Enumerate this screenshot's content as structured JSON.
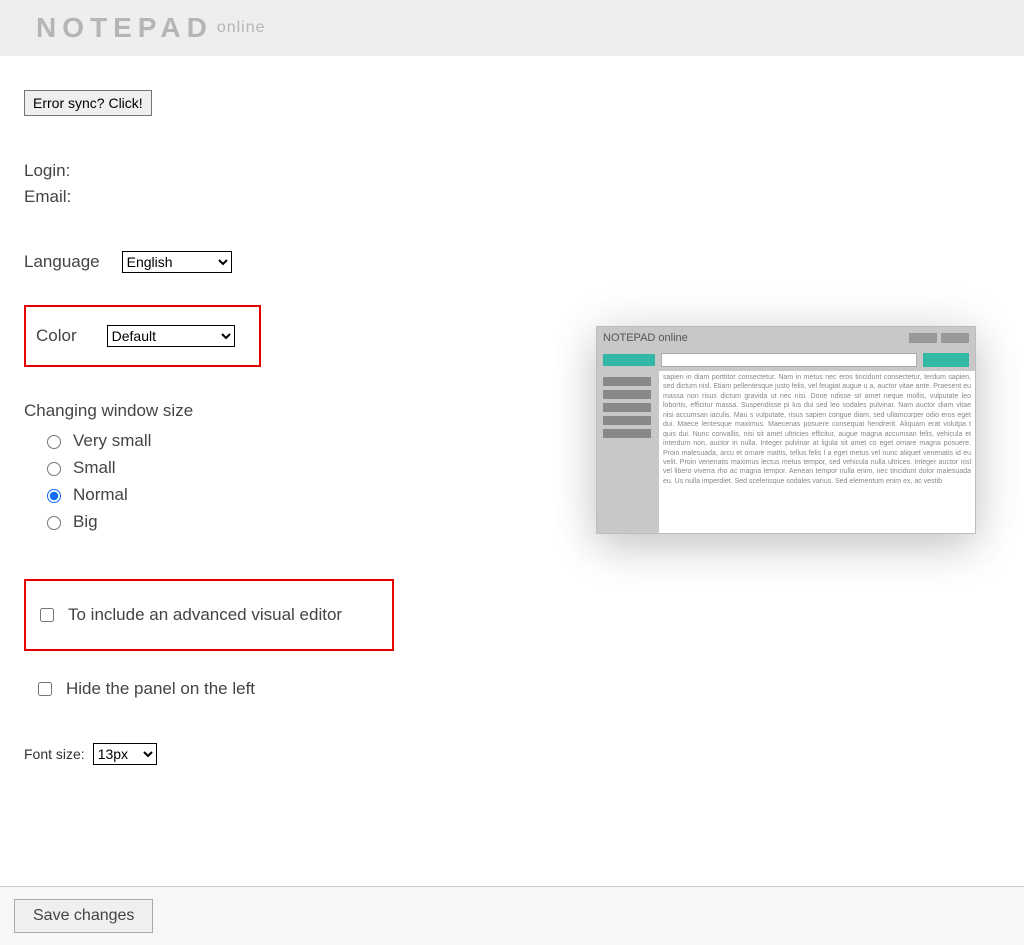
{
  "header": {
    "logo_main": "NOTEPAD",
    "logo_sub": "online"
  },
  "error_sync_btn": "Error sync? Click!",
  "login_label": "Login:",
  "email_label": "Email:",
  "language": {
    "label": "Language",
    "selected": "English"
  },
  "color": {
    "label": "Color",
    "selected": "Default"
  },
  "window_size": {
    "title": "Changing window size",
    "options": [
      "Very small",
      "Small",
      "Normal",
      "Big"
    ],
    "selected_index": 2
  },
  "advanced_editor": {
    "label": "To include an advanced visual editor",
    "checked": false
  },
  "hide_panel": {
    "label": "Hide the panel on the left",
    "checked": false
  },
  "font_size": {
    "label": "Font size:",
    "selected": "13px"
  },
  "save_btn": "Save changes",
  "preview": {
    "title": "NOTEPAD online",
    "lorem": "sapien in diam porttitor consectetur. Nam in metus nec eros tincidunt consectetur, terdum sapien, sed dictum nisl. Etiam pellentesque justo felis, vel feugiat augue u a, auctor vitae ante. Praesent eu massa non risus dictum gravida ut nec nisi. Done ndisse sit amet neque mollis, vulputate leo lobortis, efficitur massa. Suspendisse pi lus dui sed leo sodales pulvinar. Nam auctor diam vitae nisi accumsan iaculis. Mau s vulputate, risus sapien congue diam, sed ullamcorper odio eros eget dui. Maece lentesque maximus. Maecenas posuere consequat hendrerit. Aliquam erat volutpa t quis dui. Nunc convallis, nisi sit amet ultricies efficitur, augue magna accumsan felis, vehicula et interdum non, auctor in nulla. Integer pulvinar at ligula sit amet co eget ornare magna posuere. Proin malesuada, arcu et ornare mattis, tellus felis l a eget metus vel nunc aliquet venenatis id eu velit. Proin venenatis maximus lectus metus tempor, sed vehicula nulla ultrices. Integer auctor nisl vel libero viverra rho ac magna tempor. Aenean tempor nulla enim, nec tincidunt dolor malesuada eu. Us nulla imperdiet. Sed scelerisque sodales varius. Sed elementum enim ex, ac vestib"
  }
}
